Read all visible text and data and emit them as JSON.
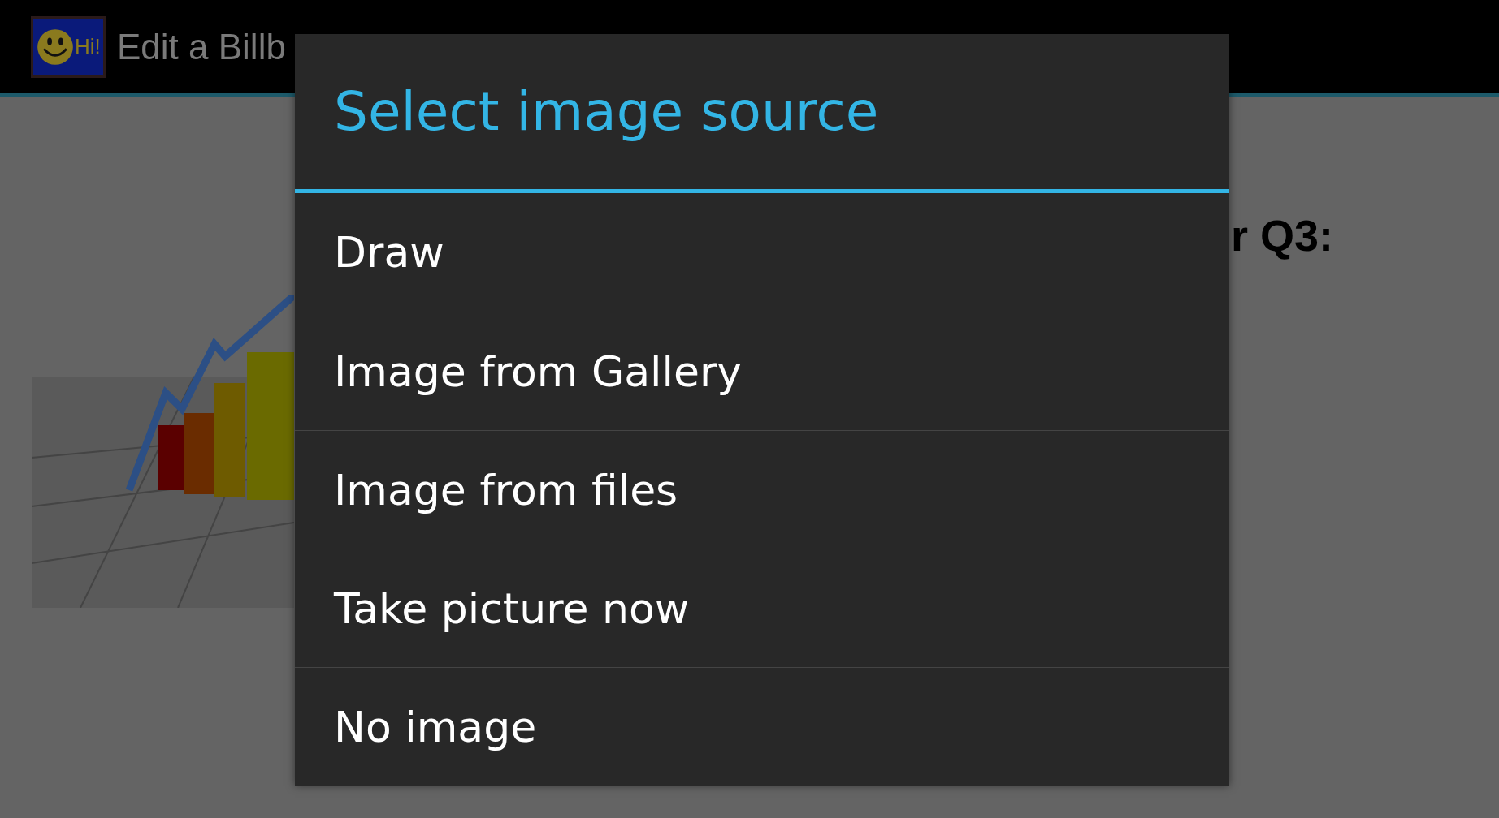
{
  "action_bar": {
    "logo_text": "Hi!",
    "title": "Edit a Billb"
  },
  "content": {
    "heading": "r Q3:"
  },
  "dialog": {
    "title": "Select image source",
    "items": [
      {
        "label": "Draw"
      },
      {
        "label": "Image from Gallery"
      },
      {
        "label": "Image from files"
      },
      {
        "label": "Take picture now"
      },
      {
        "label": "No image"
      }
    ]
  }
}
